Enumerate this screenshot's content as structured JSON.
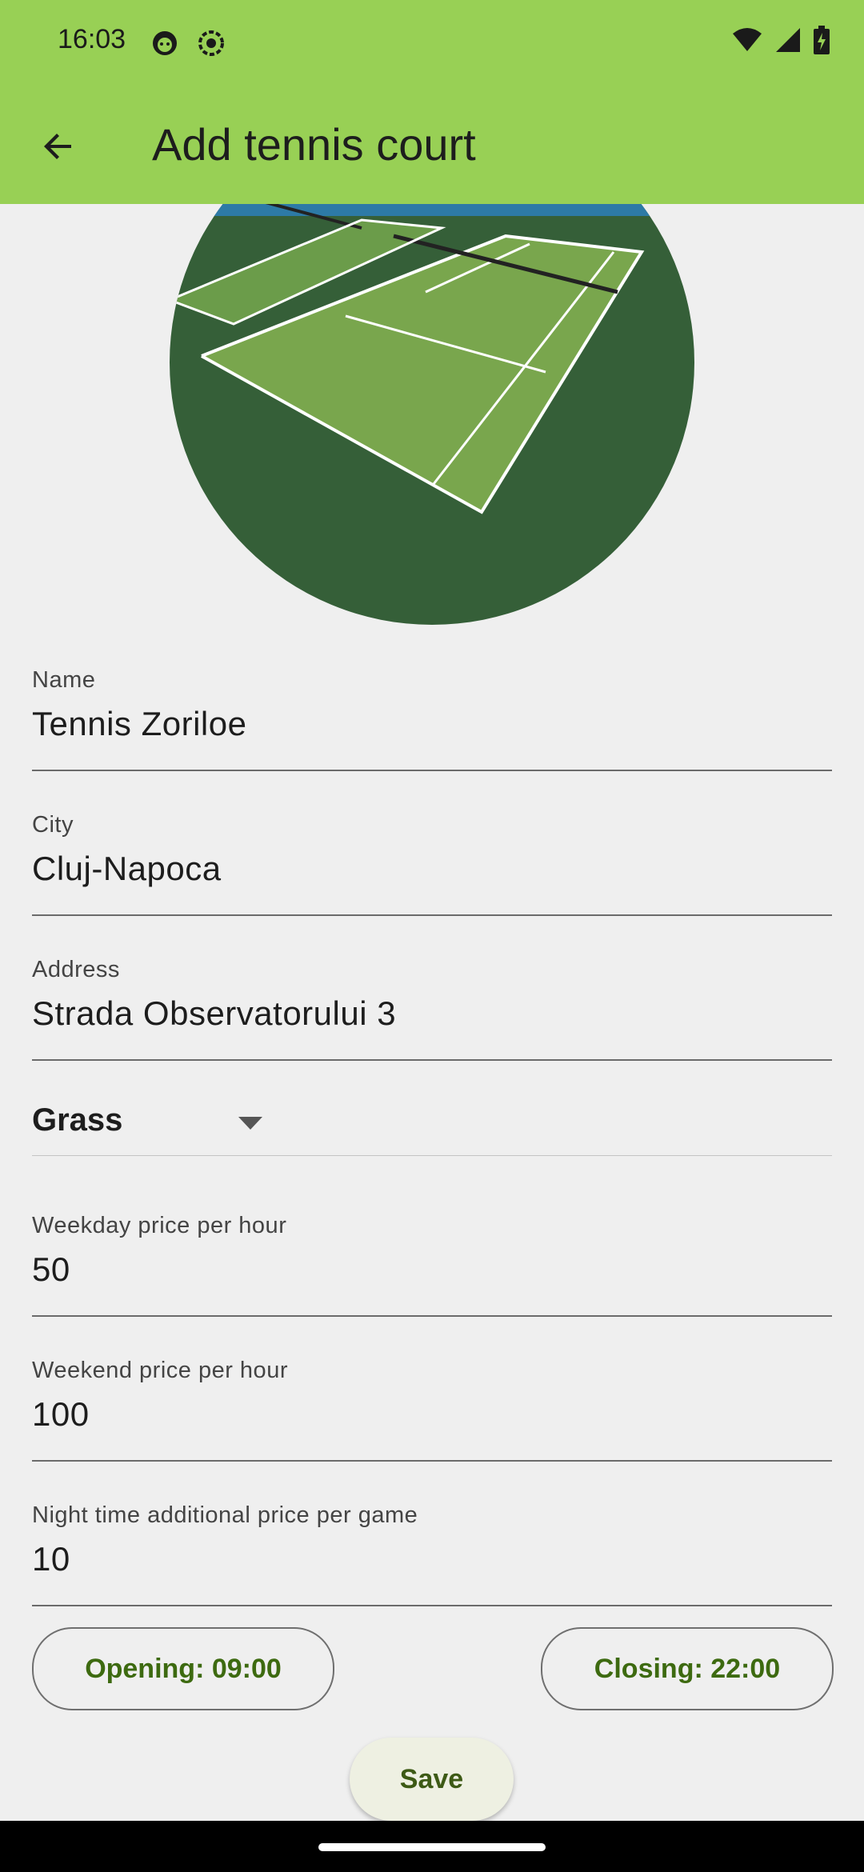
{
  "status": {
    "time": "16:03"
  },
  "appbar": {
    "title": "Add tennis court"
  },
  "form": {
    "name": {
      "label": "Name",
      "value": "Tennis Zoriloe"
    },
    "city": {
      "label": "City",
      "value": "Cluj-Napoca"
    },
    "address": {
      "label": "Address",
      "value": "Strada Observatorului 3"
    },
    "surface": {
      "selected": "Grass"
    },
    "weekday_price": {
      "label": "Weekday price per hour",
      "value": "50"
    },
    "weekend_price": {
      "label": "Weekend price per hour",
      "value": "100"
    },
    "night_price": {
      "label": "Night time additional price per game",
      "value": "10"
    }
  },
  "buttons": {
    "opening": "Opening: 09:00",
    "closing": "Closing: 22:00",
    "save": "Save"
  },
  "colors": {
    "appbar": "#98d055",
    "button_text": "#3d6a10",
    "background": "#efefef"
  }
}
